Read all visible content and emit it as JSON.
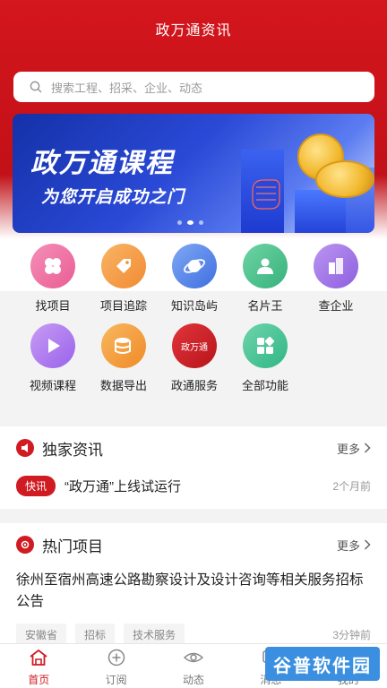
{
  "header": {
    "title": "政万通资讯"
  },
  "search": {
    "placeholder": "搜索工程、招采、企业、动态"
  },
  "banner": {
    "line1": "政万通课程",
    "line2": "为您开启成功之门"
  },
  "grid": {
    "items": [
      {
        "label": "找项目",
        "icon": "clover-icon",
        "color": "#f07aa8"
      },
      {
        "label": "项目追踪",
        "icon": "tag-icon",
        "color": "#f6a04d"
      },
      {
        "label": "知识岛屿",
        "icon": "planet-icon",
        "color": "#5c8ff0"
      },
      {
        "label": "名片王",
        "icon": "person-card-icon",
        "color": "#4fc390"
      },
      {
        "label": "查企业",
        "icon": "building-icon",
        "color": "#a77ae8"
      },
      {
        "label": "视频课程",
        "icon": "play-icon",
        "color": "#b37cf0"
      },
      {
        "label": "数据导出",
        "icon": "database-icon",
        "color": "#f5a13c"
      },
      {
        "label": "政通服务",
        "icon": "zwt-logo-icon",
        "color": "#d01b22",
        "badge_text": "政万通"
      },
      {
        "label": "全部功能",
        "icon": "grid-icon",
        "color": "#45c39a"
      }
    ]
  },
  "exclusive": {
    "title": "独家资讯",
    "more": "更多",
    "badge": "快讯",
    "headline": "“政万通”上线试运行",
    "time": "2个月前"
  },
  "hot": {
    "title": "热门项目",
    "more": "更多",
    "project_title": "徐州至宿州高速公路勘察设计及设计咨询等相关服务招标公告",
    "tags": [
      "安徽省",
      "招标",
      "技术服务"
    ],
    "time": "3分钟前"
  },
  "tabbar": {
    "items": [
      {
        "label": "首页",
        "icon": "home-icon",
        "active": true
      },
      {
        "label": "订阅",
        "icon": "plus-circle-icon",
        "active": false
      },
      {
        "label": "动态",
        "icon": "eye-icon",
        "active": false
      },
      {
        "label": "消息",
        "icon": "message-icon",
        "active": false
      },
      {
        "label": "我的",
        "icon": "user-icon",
        "active": false
      }
    ]
  },
  "watermark": {
    "text": "谷普软件园"
  },
  "colors": {
    "brand_red": "#d01b22",
    "header_red": "#c51118"
  }
}
